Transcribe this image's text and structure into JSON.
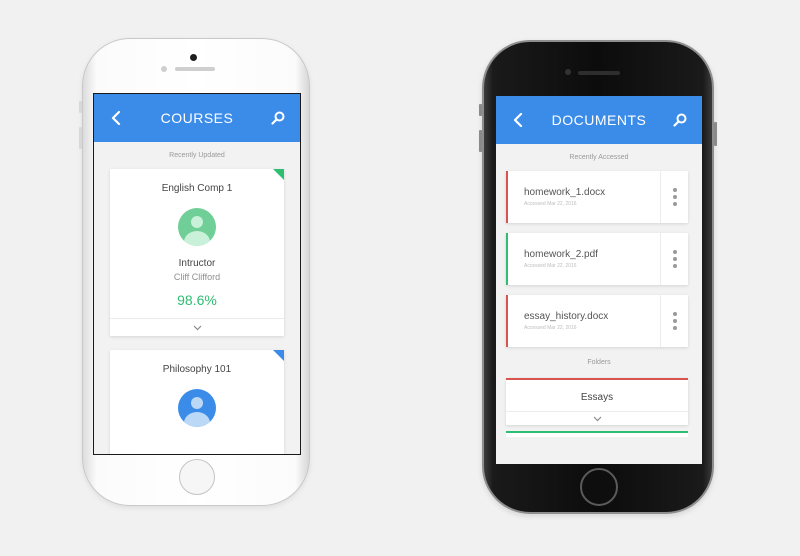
{
  "colors": {
    "header_blue": "#3b8ce8",
    "green": "#2fbd72",
    "green_avatar": "#6fcf97",
    "blue_avatar": "#3b8ce8",
    "red": "#d9534f",
    "grey_text": "#9a9a9a"
  },
  "courses_screen": {
    "title": "COURSES",
    "back_icon": "chevron-left-icon",
    "search_icon": "search-icon",
    "section_label": "Recently Updated",
    "cards": [
      {
        "name": "English Comp 1",
        "instructor_label": "Intructor",
        "instructor_name": "Cliff Clifford",
        "grade": "98.6%",
        "flag_color": "#2fbd72"
      },
      {
        "name": "Philosophy 101",
        "flag_color": "#3b8ce8"
      }
    ]
  },
  "documents_screen": {
    "title": "DOCUMENTS",
    "back_icon": "chevron-left-icon",
    "search_icon": "search-icon",
    "section_label": "Recently Accessed",
    "documents": [
      {
        "name": "homework_1.docx",
        "accessed": "Accessed Mar 22, 2016",
        "stripe_color": "#d9534f"
      },
      {
        "name": "homework_2.pdf",
        "accessed": "Accessed Mar 22, 2016",
        "stripe_color": "#2fbd72"
      },
      {
        "name": "essay_history.docx",
        "accessed": "Accessed Mar 22, 2016",
        "stripe_color": "#d9534f"
      }
    ],
    "folders_label": "Folders",
    "folders": [
      {
        "name": "Essays",
        "bar_color": "#d9534f"
      },
      {
        "bar_color": "#2fbd72"
      }
    ]
  }
}
